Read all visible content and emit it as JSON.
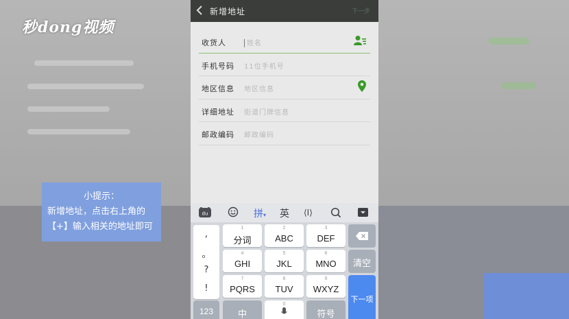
{
  "watermark": {
    "logo_text": "秒dong视频"
  },
  "tip": {
    "line1": "小提示：",
    "line2": "新增地址，点击右上角的",
    "line3": "【+】输入相关的地址即可"
  },
  "header": {
    "title": "新增地址",
    "action": "下一步"
  },
  "form": {
    "rows": [
      {
        "label": "收货人",
        "placeholder": "姓名"
      },
      {
        "label": "手机号码",
        "placeholder": "11位手机号"
      },
      {
        "label": "地区信息",
        "placeholder": "地区信息"
      },
      {
        "label": "详细地址",
        "placeholder": "街道门牌信息"
      },
      {
        "label": "邮政编码",
        "placeholder": "邮政编码"
      }
    ]
  },
  "keyboard": {
    "toolbar": {
      "logo": "du",
      "emoji_icon": "smile-icon",
      "pinyin": "拼",
      "english": "英",
      "cursor": "⟨I⟩",
      "search_icon": "search-icon",
      "hide_icon": "keyboard-hide-icon"
    },
    "punct": [
      ",",
      "。",
      "?",
      "!"
    ],
    "keys": [
      {
        "num": "1",
        "label": "分词"
      },
      {
        "num": "2",
        "label": "ABC"
      },
      {
        "num": "3",
        "label": "DEF"
      },
      {
        "num": "4",
        "label": "GHI"
      },
      {
        "num": "5",
        "label": "JKL"
      },
      {
        "num": "6",
        "label": "MNO"
      },
      {
        "num": "7",
        "label": "PQRS"
      },
      {
        "num": "8",
        "label": "TUV"
      },
      {
        "num": "9",
        "label": "WXYZ"
      }
    ],
    "delete_icon": "backspace-icon",
    "clear": "清空",
    "next": "下一项",
    "bottom": {
      "num_key": "123",
      "zh_key": "中",
      "space_num": "0",
      "symbol_key": "符号"
    }
  },
  "colors": {
    "accent_green": "#3a9a2a",
    "keyboard_blue": "#4d8af0",
    "tip_blue": "#7f9fdf",
    "titlebar": "#3b3d3b"
  }
}
